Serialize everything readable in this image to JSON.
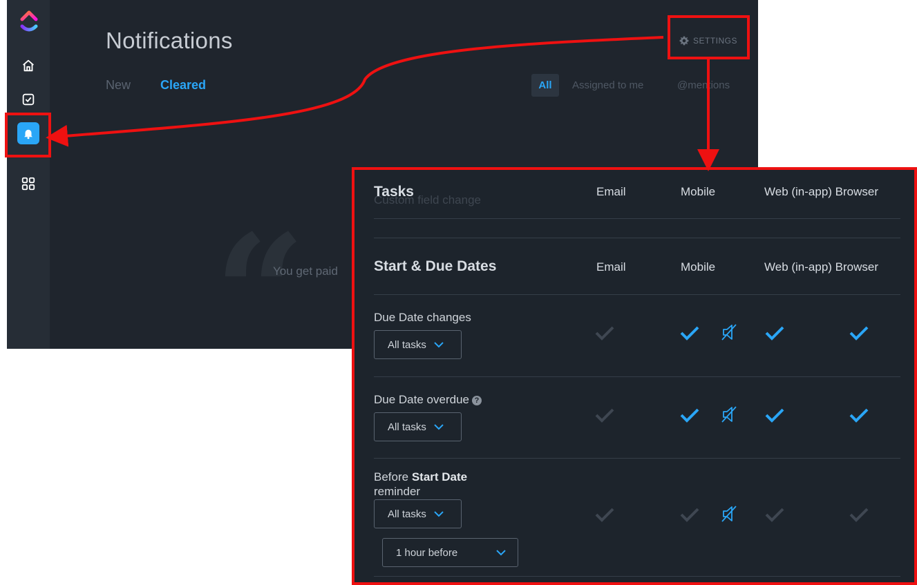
{
  "header": {
    "title": "Notifications",
    "tabs": [
      {
        "label": "New"
      },
      {
        "label": "Cleared"
      }
    ],
    "settings_label": "SETTINGS",
    "filters": [
      {
        "label": "All"
      },
      {
        "label": "Assigned to me"
      },
      {
        "label": "@mentions"
      }
    ]
  },
  "sidebar": {
    "items": [
      {
        "icon": "home-icon"
      },
      {
        "icon": "checkbox-icon"
      },
      {
        "icon": "bell-icon"
      },
      {
        "icon": "apps-grid-icon"
      }
    ]
  },
  "empty_state": {
    "text": "You get paid"
  },
  "settings_panel": {
    "columns": [
      "Email",
      "Mobile",
      "Web (in-app)",
      "Browser"
    ],
    "tasks_section": {
      "title": "Tasks",
      "ghost_text": "Custom field change",
      "col_email": "Email",
      "col_mobile": "Mobile",
      "col_web_browser": "Web (in-app) Browser"
    },
    "dates_section": {
      "title": "Start & Due Dates",
      "col_email": "Email",
      "col_mobile": "Mobile",
      "col_web_browser": "Web (in-app) Browser"
    },
    "rows": [
      {
        "label": "Due Date changes",
        "dropdown": "All tasks",
        "email": false,
        "mobile": true,
        "web": true,
        "browser": true
      },
      {
        "label": "Due Date overdue",
        "dropdown": "All tasks",
        "email": false,
        "mobile": true,
        "web": true,
        "browser": true
      },
      {
        "label_prefix": "Before ",
        "label_bold": "Start Date",
        "label_suffix": "reminder",
        "dropdown": "All tasks",
        "timing": "1 hour before",
        "email": false,
        "mobile": false,
        "web": false,
        "browser": false
      }
    ]
  },
  "colors": {
    "accent": "#2aa6f7",
    "highlight": "#ee1111",
    "background": "#1f252d",
    "check_off": "#3f4752"
  }
}
